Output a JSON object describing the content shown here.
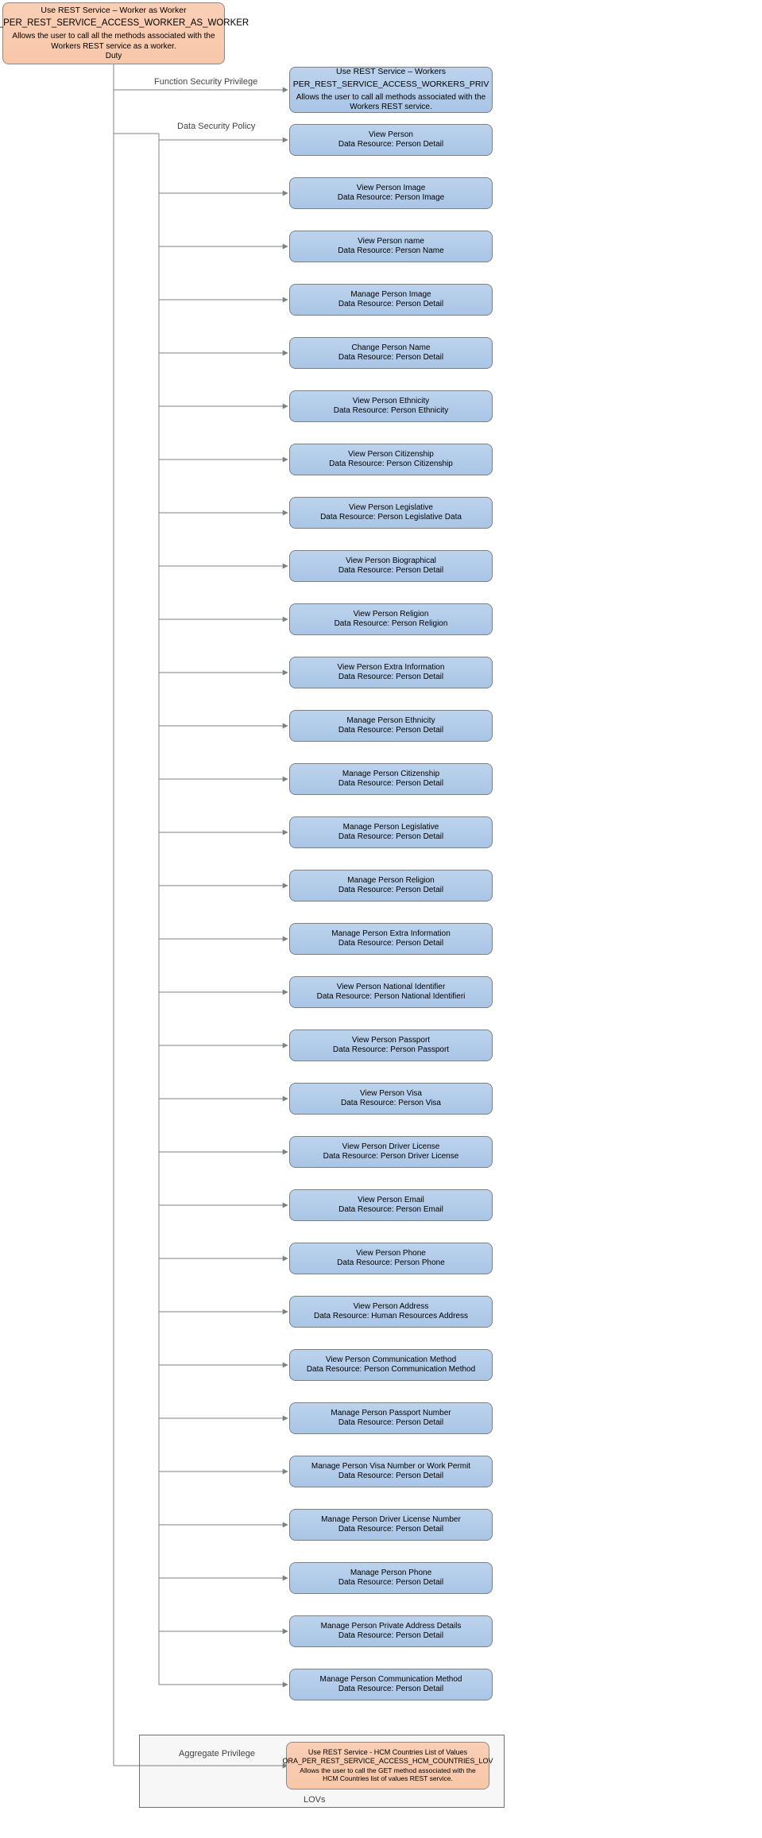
{
  "root": {
    "line1": "Use REST Service – Worker as Worker",
    "line2": "ORA_PER_REST_SERVICE_ACCESS_WORKER_AS_WORKER",
    "line3": "Allows the user to call all the methods associated with the Workers REST service as a worker.",
    "line4": "Duty"
  },
  "labels": {
    "fsp": "Function Security Privilege",
    "dsp": "Data Security Policy",
    "agg": "Aggregate Privilege",
    "lovs": "LOVs"
  },
  "fsp_node": {
    "line1": "Use REST Service – Workers",
    "line2": "PER_REST_SERVICE_ACCESS_WORKERS_PRIV",
    "line3": "Allows the user to call all methods associated with the Workers REST service."
  },
  "agg_node": {
    "line1": "Use REST Service - HCM Countries List of Values",
    "line2": "ORA_PER_REST_SERVICE_ACCESS_HCM_COUNTRIES_LOV",
    "line3": "Allows the user to call the GET method associated with the HCM Countries list of values REST service."
  },
  "dsp_nodes": [
    {
      "l1": "View Person",
      "l2": "Data Resource: Person Detail"
    },
    {
      "l1": "View Person Image",
      "l2": "Data Resource: Person Image"
    },
    {
      "l1": "View Person name",
      "l2": "Data Resource: Person Name"
    },
    {
      "l1": "Manage Person Image",
      "l2": "Data Resource: Person Detail"
    },
    {
      "l1": "Change Person Name",
      "l2": "Data Resource: Person Detail"
    },
    {
      "l1": "View Person Ethnicity",
      "l2": "Data Resource: Person Ethnicity"
    },
    {
      "l1": "View Person Citizenship",
      "l2": "Data Resource: Person Citizenship"
    },
    {
      "l1": "View Person Legislative",
      "l2": "Data Resource: Person Legislative Data"
    },
    {
      "l1": "View Person Biographical",
      "l2": "Data Resource: Person Detail"
    },
    {
      "l1": "View Person Religion",
      "l2": "Data Resource: Person Religion"
    },
    {
      "l1": "View Person Extra Information",
      "l2": "Data Resource: Person Detail"
    },
    {
      "l1": "Manage Person Ethnicity",
      "l2": "Data Resource: Person Detail"
    },
    {
      "l1": "Manage Person Citizenship",
      "l2": "Data Resource: Person Detail"
    },
    {
      "l1": "Manage Person Legislative",
      "l2": "Data Resource: Person Detail"
    },
    {
      "l1": "Manage Person Religion",
      "l2": "Data Resource: Person Detail"
    },
    {
      "l1": "Manage Person Extra Information",
      "l2": "Data Resource: Person Detail"
    },
    {
      "l1": "View Person National Identifier",
      "l2": "Data Resource: Person National Identifieri"
    },
    {
      "l1": "View Person Passport",
      "l2": "Data Resource: Person Passport"
    },
    {
      "l1": "View Person Visa",
      "l2": "Data Resource: Person Visa"
    },
    {
      "l1": "View Person Driver License",
      "l2": "Data Resource: Person Driver License"
    },
    {
      "l1": "View Person Email",
      "l2": "Data Resource: Person Email"
    },
    {
      "l1": "View Person Phone",
      "l2": "Data Resource: Person Phone"
    },
    {
      "l1": "View Person Address",
      "l2": "Data Resource:  Human Resources Address"
    },
    {
      "l1": "View Person Communication Method",
      "l2": "Data Resource: Person Communication Method"
    },
    {
      "l1": "Manage Person Passport Number",
      "l2": "Data Resource: Person Detail"
    },
    {
      "l1": "Manage Person Visa Number or Work Permit",
      "l2": "Data Resource: Person Detail"
    },
    {
      "l1": "Manage Person Driver License Number",
      "l2": "Data Resource: Person Detail"
    },
    {
      "l1": "Manage Person Phone",
      "l2": "Data Resource: Person Detail"
    },
    {
      "l1": "Manage Person Private Address Details",
      "l2": "Data Resource: Person Detail"
    },
    {
      "l1": "Manage Person Communication Method",
      "l2": "Data Resource: Person Detail"
    }
  ]
}
